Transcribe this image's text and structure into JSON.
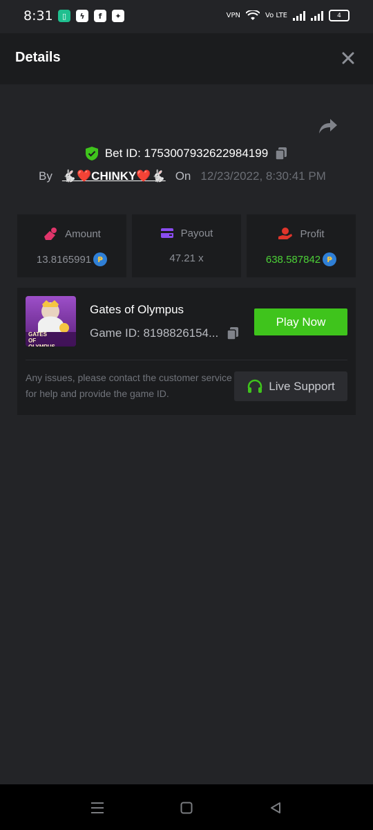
{
  "status_bar": {
    "time": "8:31",
    "battery": "4",
    "vpn": "VPN",
    "volte": "Vo LTE"
  },
  "header": {
    "title": "Details"
  },
  "bet": {
    "bet_id_label": "Bet ID: 1753007932622984199",
    "by_label": "By",
    "user": "🐇❤️CHINKY❤️🐇",
    "on_label": "On",
    "datetime": "12/23/2022, 8:30:41 PM"
  },
  "stats": {
    "amount": {
      "label": "Amount",
      "value": "13.8165991"
    },
    "payout": {
      "label": "Payout",
      "value": "47.21 x"
    },
    "profit": {
      "label": "Profit",
      "value": "638.587842"
    }
  },
  "game": {
    "name": "Gates of Olympus",
    "game_id": "Game ID: 8198826154...",
    "thumb_text": "GATES OF OLYMPUS",
    "play_label": "Play Now",
    "help_text": "Any issues, please contact the customer service for help and provide the game ID.",
    "support_label": "Live Support"
  },
  "colors": {
    "background": "#232427",
    "card": "#1b1c1e",
    "accent_green": "#3fc41c",
    "profit_green": "#4cd137",
    "coin_blue": "#2f7fd6"
  }
}
